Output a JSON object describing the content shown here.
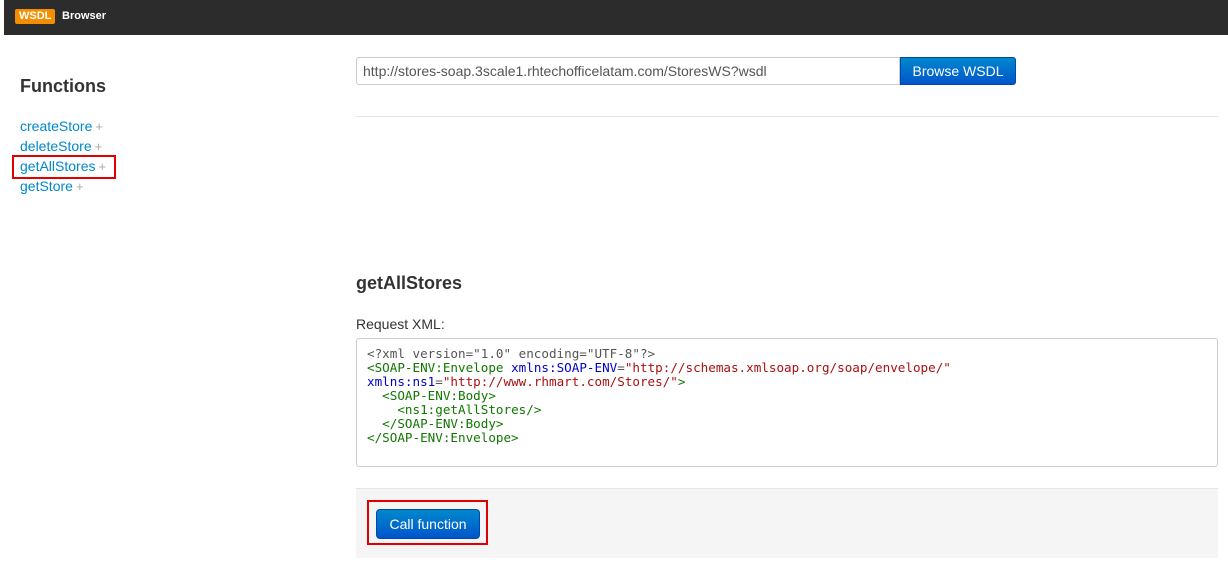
{
  "header": {
    "logo_badge": "WSDL",
    "brand": "Browser"
  },
  "sidebar": {
    "title": "Functions",
    "plus_glyph": "+",
    "items": [
      {
        "label": "createStore",
        "selected": false
      },
      {
        "label": "deleteStore",
        "selected": false
      },
      {
        "label": "getAllStores",
        "selected": true
      },
      {
        "label": "getStore",
        "selected": false
      }
    ]
  },
  "toolbar": {
    "wsdl_url": "http://stores-soap.3scale1.rhtechofficelatam.com/StoresWS?wsdl",
    "browse_label": "Browse WSDL"
  },
  "main": {
    "function_title": "getAllStores",
    "request_label": "Request XML:",
    "xml": {
      "declaration": "<?xml version=\"1.0\" encoding=\"UTF-8\"?>",
      "envelope_open": "<SOAP-ENV:Envelope",
      "attr_env_name": "xmlns:SOAP-ENV",
      "attr_env_value": "\"http://schemas.xmlsoap.org/soap/envelope/\"",
      "attr_ns1_name": "xmlns:ns1",
      "attr_ns1_value": "\"http://www.rhmart.com/Stores/\"",
      "gt": ">",
      "eq": "=",
      "body_open": "<SOAP-ENV:Body>",
      "call": "<ns1:getAllStores/>",
      "body_close": "</SOAP-ENV:Body>",
      "envelope_close": "</SOAP-ENV:Envelope>"
    },
    "call_label": "Call function"
  },
  "colors": {
    "accent": "#0088cc",
    "logo": "#f28e00",
    "highlight": "#e00000"
  }
}
